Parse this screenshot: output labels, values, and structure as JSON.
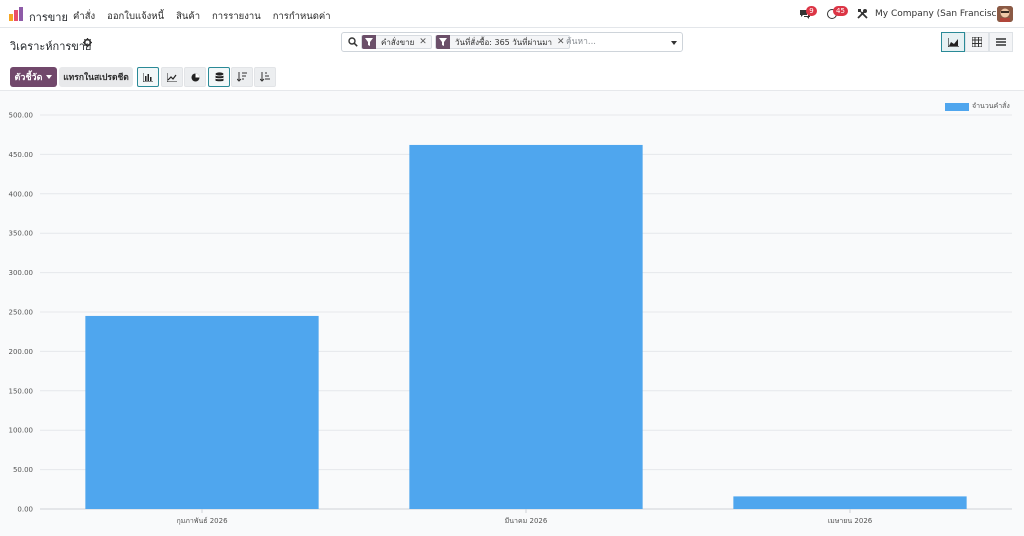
{
  "navbar": {
    "app_name": "การขาย",
    "menu": [
      "คำสั่ง",
      "ออกใบแจ้งหนี้",
      "สินค้า",
      "การรายงาน",
      "การกำหนดค่า"
    ],
    "messages_count": "9",
    "activities_count": "45",
    "company": "My Company (San Francisco)"
  },
  "control_panel": {
    "title": "วิเคราะห์การขาย",
    "search": {
      "facets": [
        {
          "label": "คำสั่งขาย"
        },
        {
          "label": "วันที่สั่งซื้อ: 365 วันที่ผ่านมา"
        }
      ],
      "placeholder": "ค้นหา..."
    },
    "measures_label": "ตัวชี้วัด",
    "insert_label": "แทรกในสเปรดชีต"
  },
  "chart_data": {
    "type": "bar",
    "categories": [
      "กุมภาพันธ์ 2026",
      "มีนาคม 2026",
      "เมษายน 2026"
    ],
    "series": [
      {
        "name": "จำนวนคำสั่ง",
        "values": [
          245,
          462,
          16
        ]
      }
    ],
    "ylim": [
      0,
      500
    ],
    "yticks": [
      "0.00",
      "50.00",
      "100.00",
      "150.00",
      "200.00",
      "250.00",
      "300.00",
      "350.00",
      "400.00",
      "450.00",
      "500.00"
    ],
    "grid": true,
    "legend_position": "top-right",
    "bar_color": "#4fa6ee"
  }
}
